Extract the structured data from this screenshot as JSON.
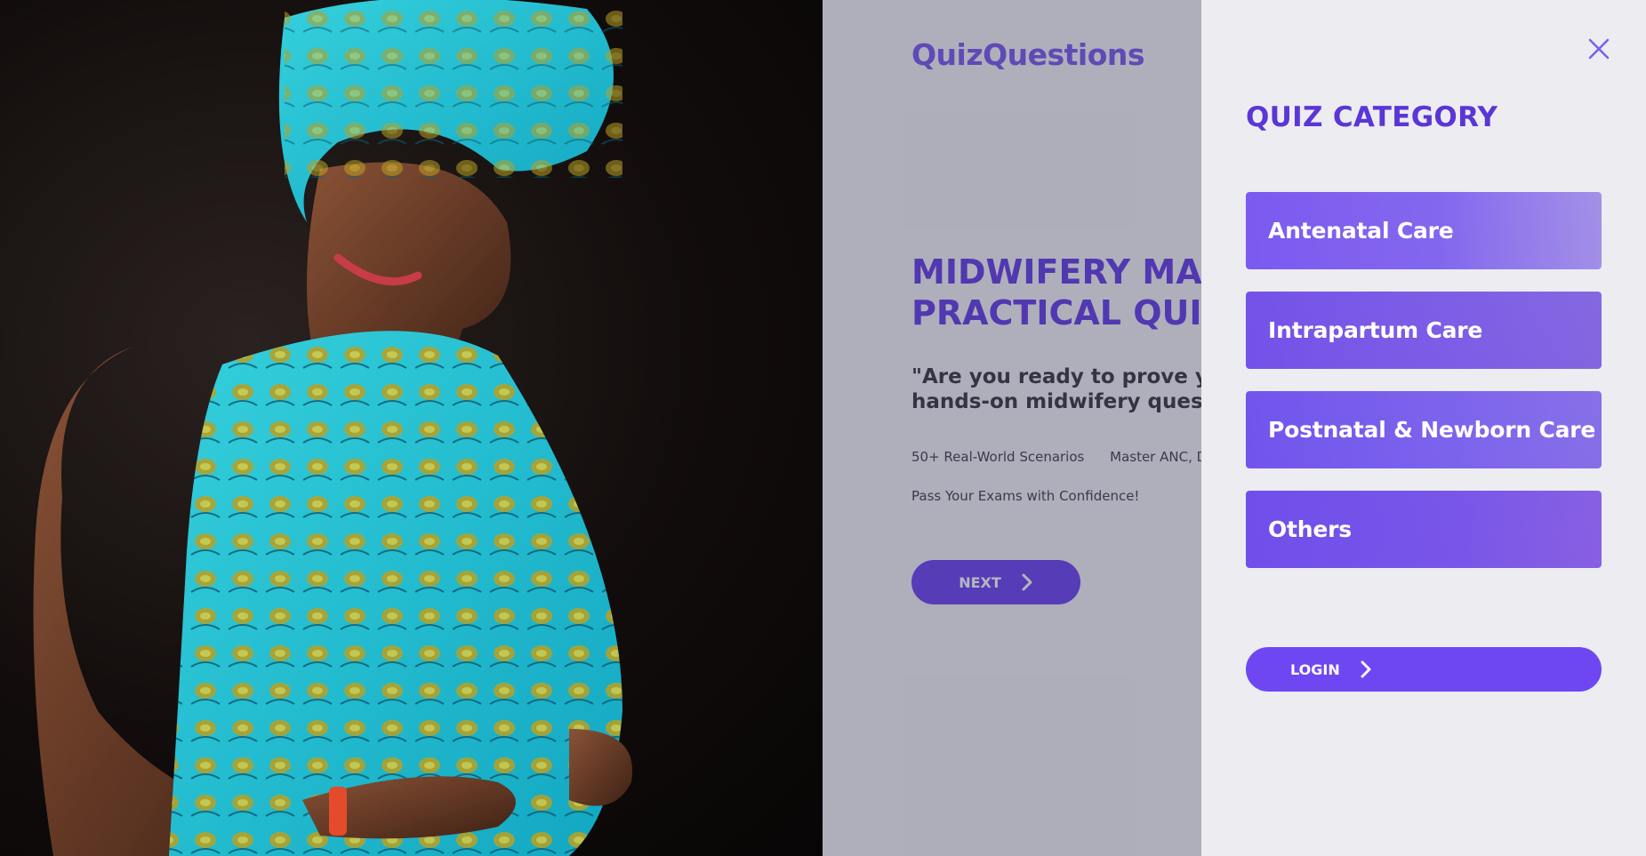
{
  "app": {
    "logo_text": "QuizQuestions"
  },
  "hero": {
    "image_icon": "pregnant-woman-photo",
    "title_line1": "MIDWIFERY MAS",
    "title_line2": "PRACTICAL QUIZ",
    "quote_line1": "\"Are you ready to prove you",
    "quote_line2": "hands-on midwifery questio",
    "features": [
      "50+ Real-World Scenarios",
      "Master ANC, De"
    ],
    "feature_line2": "Pass Your Exams with Confidence!",
    "next_label": "NEXT",
    "next_icon": "chevron-right-icon"
  },
  "drawer": {
    "close_icon": "close-icon",
    "title": "QUIZ CATEGORY",
    "categories": [
      {
        "label": "Antenatal Care"
      },
      {
        "label": "Intrapartum Care"
      },
      {
        "label": "Postnatal & Newborn Care"
      },
      {
        "label": "Others"
      }
    ],
    "login_label": "LOGIN",
    "login_icon": "chevron-right-icon"
  },
  "colors": {
    "accent": "#6f47f2",
    "title": "#5a36d6",
    "card_overlay": "#7b5cf0",
    "drawer_bg": "#ececf1"
  }
}
